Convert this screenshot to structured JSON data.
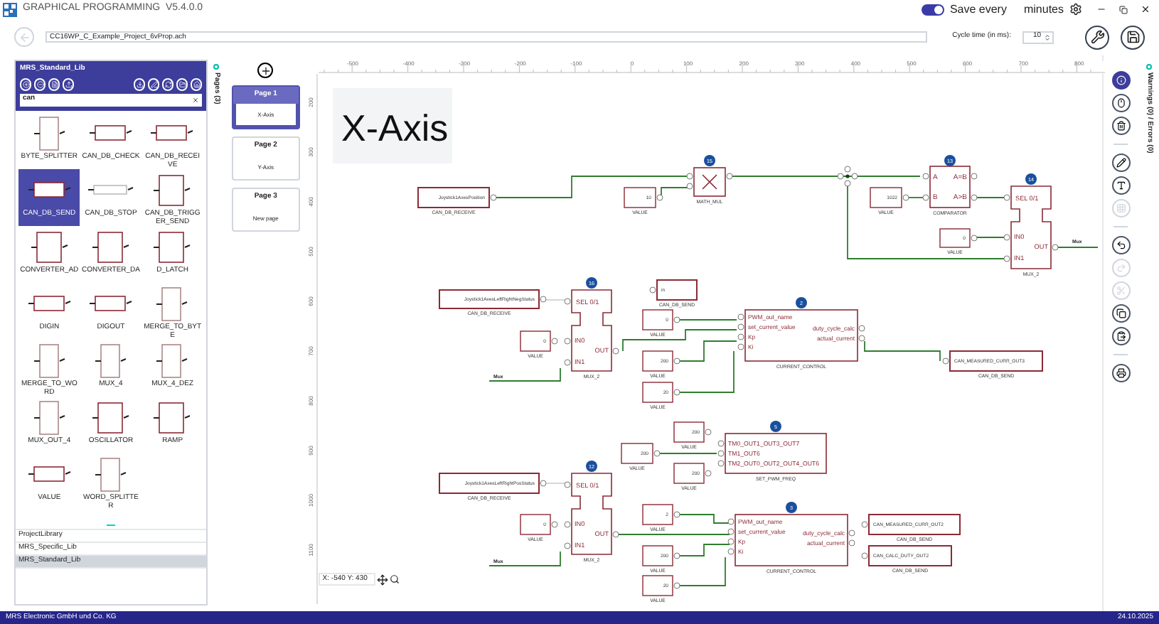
{
  "app": {
    "title": "GRAPHICAL PROGRAMMING  V5.4.0.0",
    "autosave_on": true,
    "save_label": "Save every",
    "minutes_label": "minutes"
  },
  "project": {
    "path": "CC16WP_C_Example_Project_6vProp.ach",
    "cycle_label": "Cycle time (in ms):",
    "cycle_value": "10"
  },
  "library": {
    "title": "MRS_Standard_Lib",
    "search": "can",
    "items": [
      {
        "name": "BYTE_SPLITTER",
        "selected": false
      },
      {
        "name": "CAN_DB_CHECK",
        "selected": false
      },
      {
        "name": "CAN_DB_RECEIVE",
        "selected": false
      },
      {
        "name": "CAN_DB_SEND",
        "selected": true
      },
      {
        "name": "CAN_DB_STOP",
        "selected": false
      },
      {
        "name": "CAN_DB_TRIGGER_SEND",
        "selected": false
      },
      {
        "name": "CONVERTER_AD",
        "selected": false
      },
      {
        "name": "CONVERTER_DA",
        "selected": false
      },
      {
        "name": "D_LATCH",
        "selected": false
      },
      {
        "name": "DIGIN",
        "selected": false
      },
      {
        "name": "DIGOUT",
        "selected": false
      },
      {
        "name": "MERGE_TO_BYTE",
        "selected": false
      },
      {
        "name": "MERGE_TO_WORD",
        "selected": false
      },
      {
        "name": "MUX_4",
        "selected": false
      },
      {
        "name": "MUX_4_DEZ",
        "selected": false
      },
      {
        "name": "MUX_OUT_4",
        "selected": false
      },
      {
        "name": "OSCILLATOR",
        "selected": false
      },
      {
        "name": "RAMP",
        "selected": false
      },
      {
        "name": "VALUE",
        "selected": false
      },
      {
        "name": "WORD_SPLITTER",
        "selected": false
      }
    ],
    "libraries": [
      {
        "name": "ProjectLibrary",
        "selected": false
      },
      {
        "name": "MRS_Specific_Lib",
        "selected": false
      },
      {
        "name": "MRS_Standard_Lib",
        "selected": true
      }
    ]
  },
  "pages": {
    "tab": "Pages (3)",
    "items": [
      {
        "title": "Page 1",
        "subtitle": "X-Axis",
        "selected": true
      },
      {
        "title": "Page 2",
        "subtitle": "Y-Axis",
        "selected": false
      },
      {
        "title": "Page 3",
        "subtitle": "New page",
        "selected": false
      }
    ]
  },
  "canvas": {
    "heading": "X-Axis",
    "coords": "X: -540 Y: 430",
    "x_ruler": [
      "-500",
      "-400",
      "-300",
      "-200",
      "-100",
      "0",
      "100",
      "200",
      "300",
      "400",
      "500",
      "600",
      "700",
      "800"
    ],
    "y_ruler": [
      "200",
      "300",
      "400",
      "500",
      "600",
      "700",
      "800",
      "900",
      "1000",
      "1100"
    ],
    "signals": [
      {
        "label": "Mux"
      },
      {
        "label": "Mux"
      },
      {
        "label": "Mux"
      }
    ],
    "nodes": [
      {
        "kind": "receive",
        "text": "Joystick1AxesPosition",
        "caption": "CAN_DB_RECEIVE"
      },
      {
        "kind": "value",
        "text": "10",
        "caption": "VALUE"
      },
      {
        "kind": "mul",
        "badge": "15",
        "caption": "MATH_MUL"
      },
      {
        "kind": "value",
        "text": "1022",
        "caption": "VALUE"
      },
      {
        "kind": "comparator",
        "badge": "13",
        "inputs": [
          "A",
          "B"
        ],
        "outputs": [
          "A=B",
          "A>B"
        ],
        "caption": "COMPARATOR"
      },
      {
        "kind": "mux",
        "badge": "14",
        "select": "SEL 0/1",
        "inputs": [
          "IN0",
          "IN1"
        ],
        "output": "OUT",
        "caption": "MUX_2"
      },
      {
        "kind": "value",
        "text": "0",
        "caption": "VALUE"
      },
      {
        "kind": "receive",
        "text": "Joystick1AxesLeftRightNegStatus",
        "caption": "CAN_DB_RECEIVE"
      },
      {
        "kind": "mux",
        "badge": "16",
        "select": "SEL 0/1",
        "inputs": [
          "IN0",
          "IN1"
        ],
        "output": "OUT",
        "caption": "MUX_2"
      },
      {
        "kind": "value",
        "text": "0",
        "caption": "VALUE"
      },
      {
        "kind": "send",
        "text": "in",
        "caption": "CAN_DB_SEND"
      },
      {
        "kind": "value",
        "text": "0",
        "caption": "VALUE"
      },
      {
        "kind": "control",
        "badge": "2",
        "inputs": [
          "PWM_out_name",
          "set_current_value",
          "Kp",
          "Ki"
        ],
        "outputs": [
          "duty_cycle_calc",
          "actual_current"
        ],
        "caption": "CURRENT_CONTROL"
      },
      {
        "kind": "value",
        "text": "200",
        "caption": "VALUE"
      },
      {
        "kind": "value",
        "text": "20",
        "caption": "VALUE"
      },
      {
        "kind": "send",
        "text": "CAN_MEASURED_CURR_OUT3",
        "caption": "CAN_DB_SEND"
      },
      {
        "kind": "value",
        "text": "200",
        "caption": "VALUE"
      },
      {
        "kind": "value",
        "text": "200",
        "caption": "VALUE"
      },
      {
        "kind": "value",
        "text": "200",
        "caption": "VALUE"
      },
      {
        "kind": "pwm",
        "badge": "5",
        "inputs": [
          "TM0_OUT1_OUT3_OUT7",
          "TM1_OUT6",
          "TM2_OUT0_OUT2_OUT4_OUT6"
        ],
        "caption": "SET_PWM_FREQ"
      },
      {
        "kind": "receive",
        "text": "Joystick1AxesLeftRightPosStatus",
        "caption": "CAN_DB_RECEIVE"
      },
      {
        "kind": "mux",
        "badge": "12",
        "select": "SEL 0/1",
        "inputs": [
          "IN0",
          "IN1"
        ],
        "output": "OUT",
        "caption": "MUX_2"
      },
      {
        "kind": "value",
        "text": "0",
        "caption": "VALUE"
      },
      {
        "kind": "value",
        "text": "2",
        "caption": "VALUE"
      },
      {
        "kind": "value",
        "text": "200",
        "caption": "VALUE"
      },
      {
        "kind": "control",
        "badge": "3",
        "inputs": [
          "PWM_out_name",
          "set_current_value",
          "Kp",
          "Ki"
        ],
        "outputs": [
          "duty_cycle_calc",
          "actual_current"
        ],
        "caption": "CURRENT_CONTROL"
      },
      {
        "kind": "value",
        "text": "20",
        "caption": "VALUE"
      },
      {
        "kind": "send",
        "text": "CAN_MEASURED_CURR_OUT2",
        "caption": "CAN_DB_SEND"
      },
      {
        "kind": "send",
        "text": "CAN_CALC_DUTY_OUT2",
        "caption": "CAN_DB_SEND"
      }
    ]
  },
  "tools": [
    {
      "selected": true,
      "disabled": false
    },
    {
      "selected": false,
      "disabled": false
    },
    {
      "selected": false,
      "disabled": false
    },
    {
      "selected": false,
      "disabled": false
    },
    {
      "selected": false,
      "disabled": false
    },
    {
      "selected": false,
      "disabled": true
    },
    {
      "selected": false,
      "disabled": false
    },
    {
      "selected": false,
      "disabled": true
    },
    {
      "selected": false,
      "disabled": true
    },
    {
      "selected": false,
      "disabled": false
    },
    {
      "selected": false,
      "disabled": false
    },
    {
      "selected": false,
      "disabled": false
    }
  ],
  "side_tab": "Warnings (0) / Errors (0)",
  "footer": {
    "company": "MRS Electronic GmbH und Co. KG",
    "date": "24.10.2025"
  }
}
